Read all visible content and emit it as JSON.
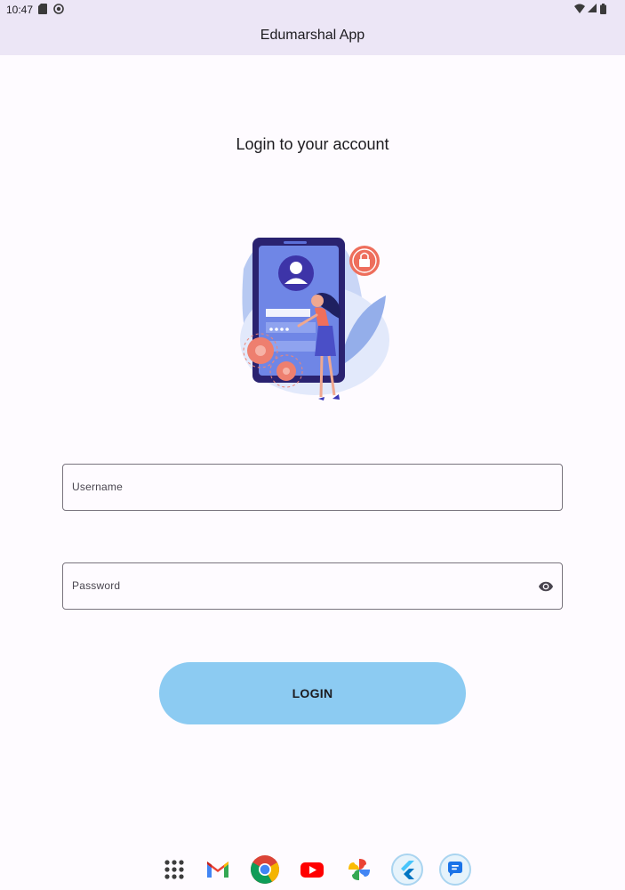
{
  "status_bar": {
    "time": "10:47",
    "left_icons": [
      "sd-card-icon",
      "sync-icon"
    ],
    "right_icons": [
      "wifi-icon",
      "signal-icon",
      "battery-icon"
    ]
  },
  "app_bar": {
    "title": "Edumarshal App"
  },
  "main": {
    "heading": "Login to your account",
    "illustration": "login-illustration",
    "username_field": {
      "placeholder": "Username",
      "value": ""
    },
    "password_field": {
      "placeholder": "Password",
      "value": "",
      "toggle_icon": "eye-icon"
    },
    "login_button": {
      "label": "LOGIN"
    }
  },
  "dock": {
    "apps": [
      "app-drawer-icon",
      "gmail-icon",
      "chrome-icon",
      "youtube-icon",
      "photos-icon",
      "flutter-icon",
      "messages-icon"
    ]
  },
  "colors": {
    "app_bar_bg": "#ece6f6",
    "page_bg": "#fefbff",
    "button_bg": "#8ccbf2",
    "field_border": "#79747e"
  }
}
